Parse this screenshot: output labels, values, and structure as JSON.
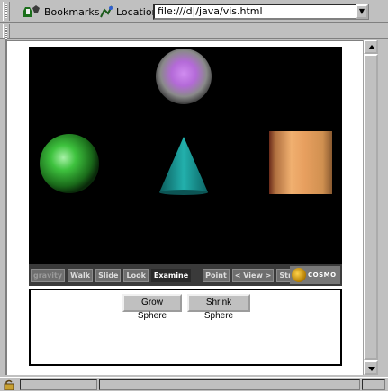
{
  "toolbar": {
    "bookmarks_label": "Bookmarks",
    "bookmarks_icon": "bookmarks-icon",
    "location_label": "Location:",
    "location_icon": "location-icon",
    "url": "file:///d|/java/vis.html"
  },
  "scene": {
    "background": "#000000",
    "objects": [
      {
        "name": "sphere-purple",
        "color": "#c878e8"
      },
      {
        "name": "sphere-green",
        "color": "#4fd24f"
      },
      {
        "name": "cone",
        "color": "#1fa3a0"
      },
      {
        "name": "cylinder",
        "color": "#e8a060"
      }
    ],
    "navbar": {
      "buttons": [
        "gravity",
        "Walk",
        "Slide",
        "Look",
        "Examine",
        "Point",
        "< View >",
        "Straighten",
        "?"
      ],
      "active": "Examine",
      "logo_text": "COSMO"
    }
  },
  "form": {
    "grow_label": "Grow Sphere",
    "shrink_label": "Shrink Sphere"
  }
}
